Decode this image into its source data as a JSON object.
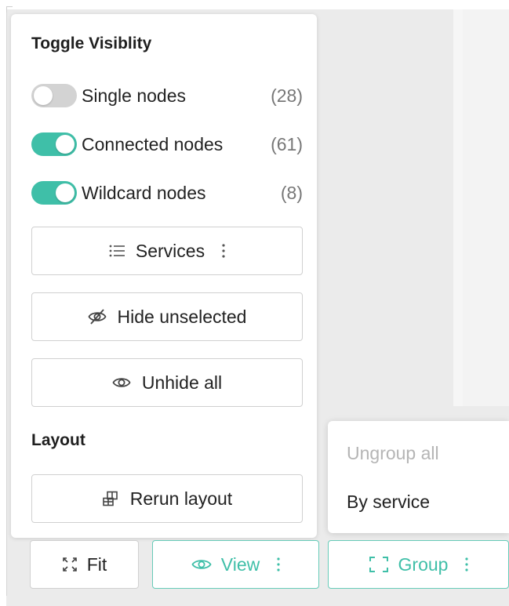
{
  "panel": {
    "visibility_title": "Toggle Visiblity",
    "toggles": [
      {
        "label": "Single nodes",
        "count": "(28)",
        "on": false
      },
      {
        "label": "Connected nodes",
        "count": "(61)",
        "on": true
      },
      {
        "label": "Wildcard nodes",
        "count": "(8)",
        "on": true
      }
    ],
    "services_label": "Services",
    "hide_unselected_label": "Hide unselected",
    "unhide_all_label": "Unhide all",
    "layout_title": "Layout",
    "rerun_layout_label": "Rerun layout"
  },
  "group_menu": {
    "ungroup_all": "Ungroup all",
    "by_service": "By service"
  },
  "toolbar": {
    "fit_label": "Fit",
    "view_label": "View",
    "group_label": "Group"
  },
  "colors": {
    "accent": "#3fbfa8",
    "toggle_off": "#d3d3d3",
    "disabled_text": "#b5b5b5"
  },
  "icons": {
    "services": "list-icon",
    "hide_unselected": "eye-off-icon",
    "unhide_all": "eye-icon",
    "rerun_layout": "layout-icon",
    "fit": "fit-icon",
    "view": "eye-icon",
    "group": "group-frame-icon",
    "more": "kebab-icon"
  }
}
